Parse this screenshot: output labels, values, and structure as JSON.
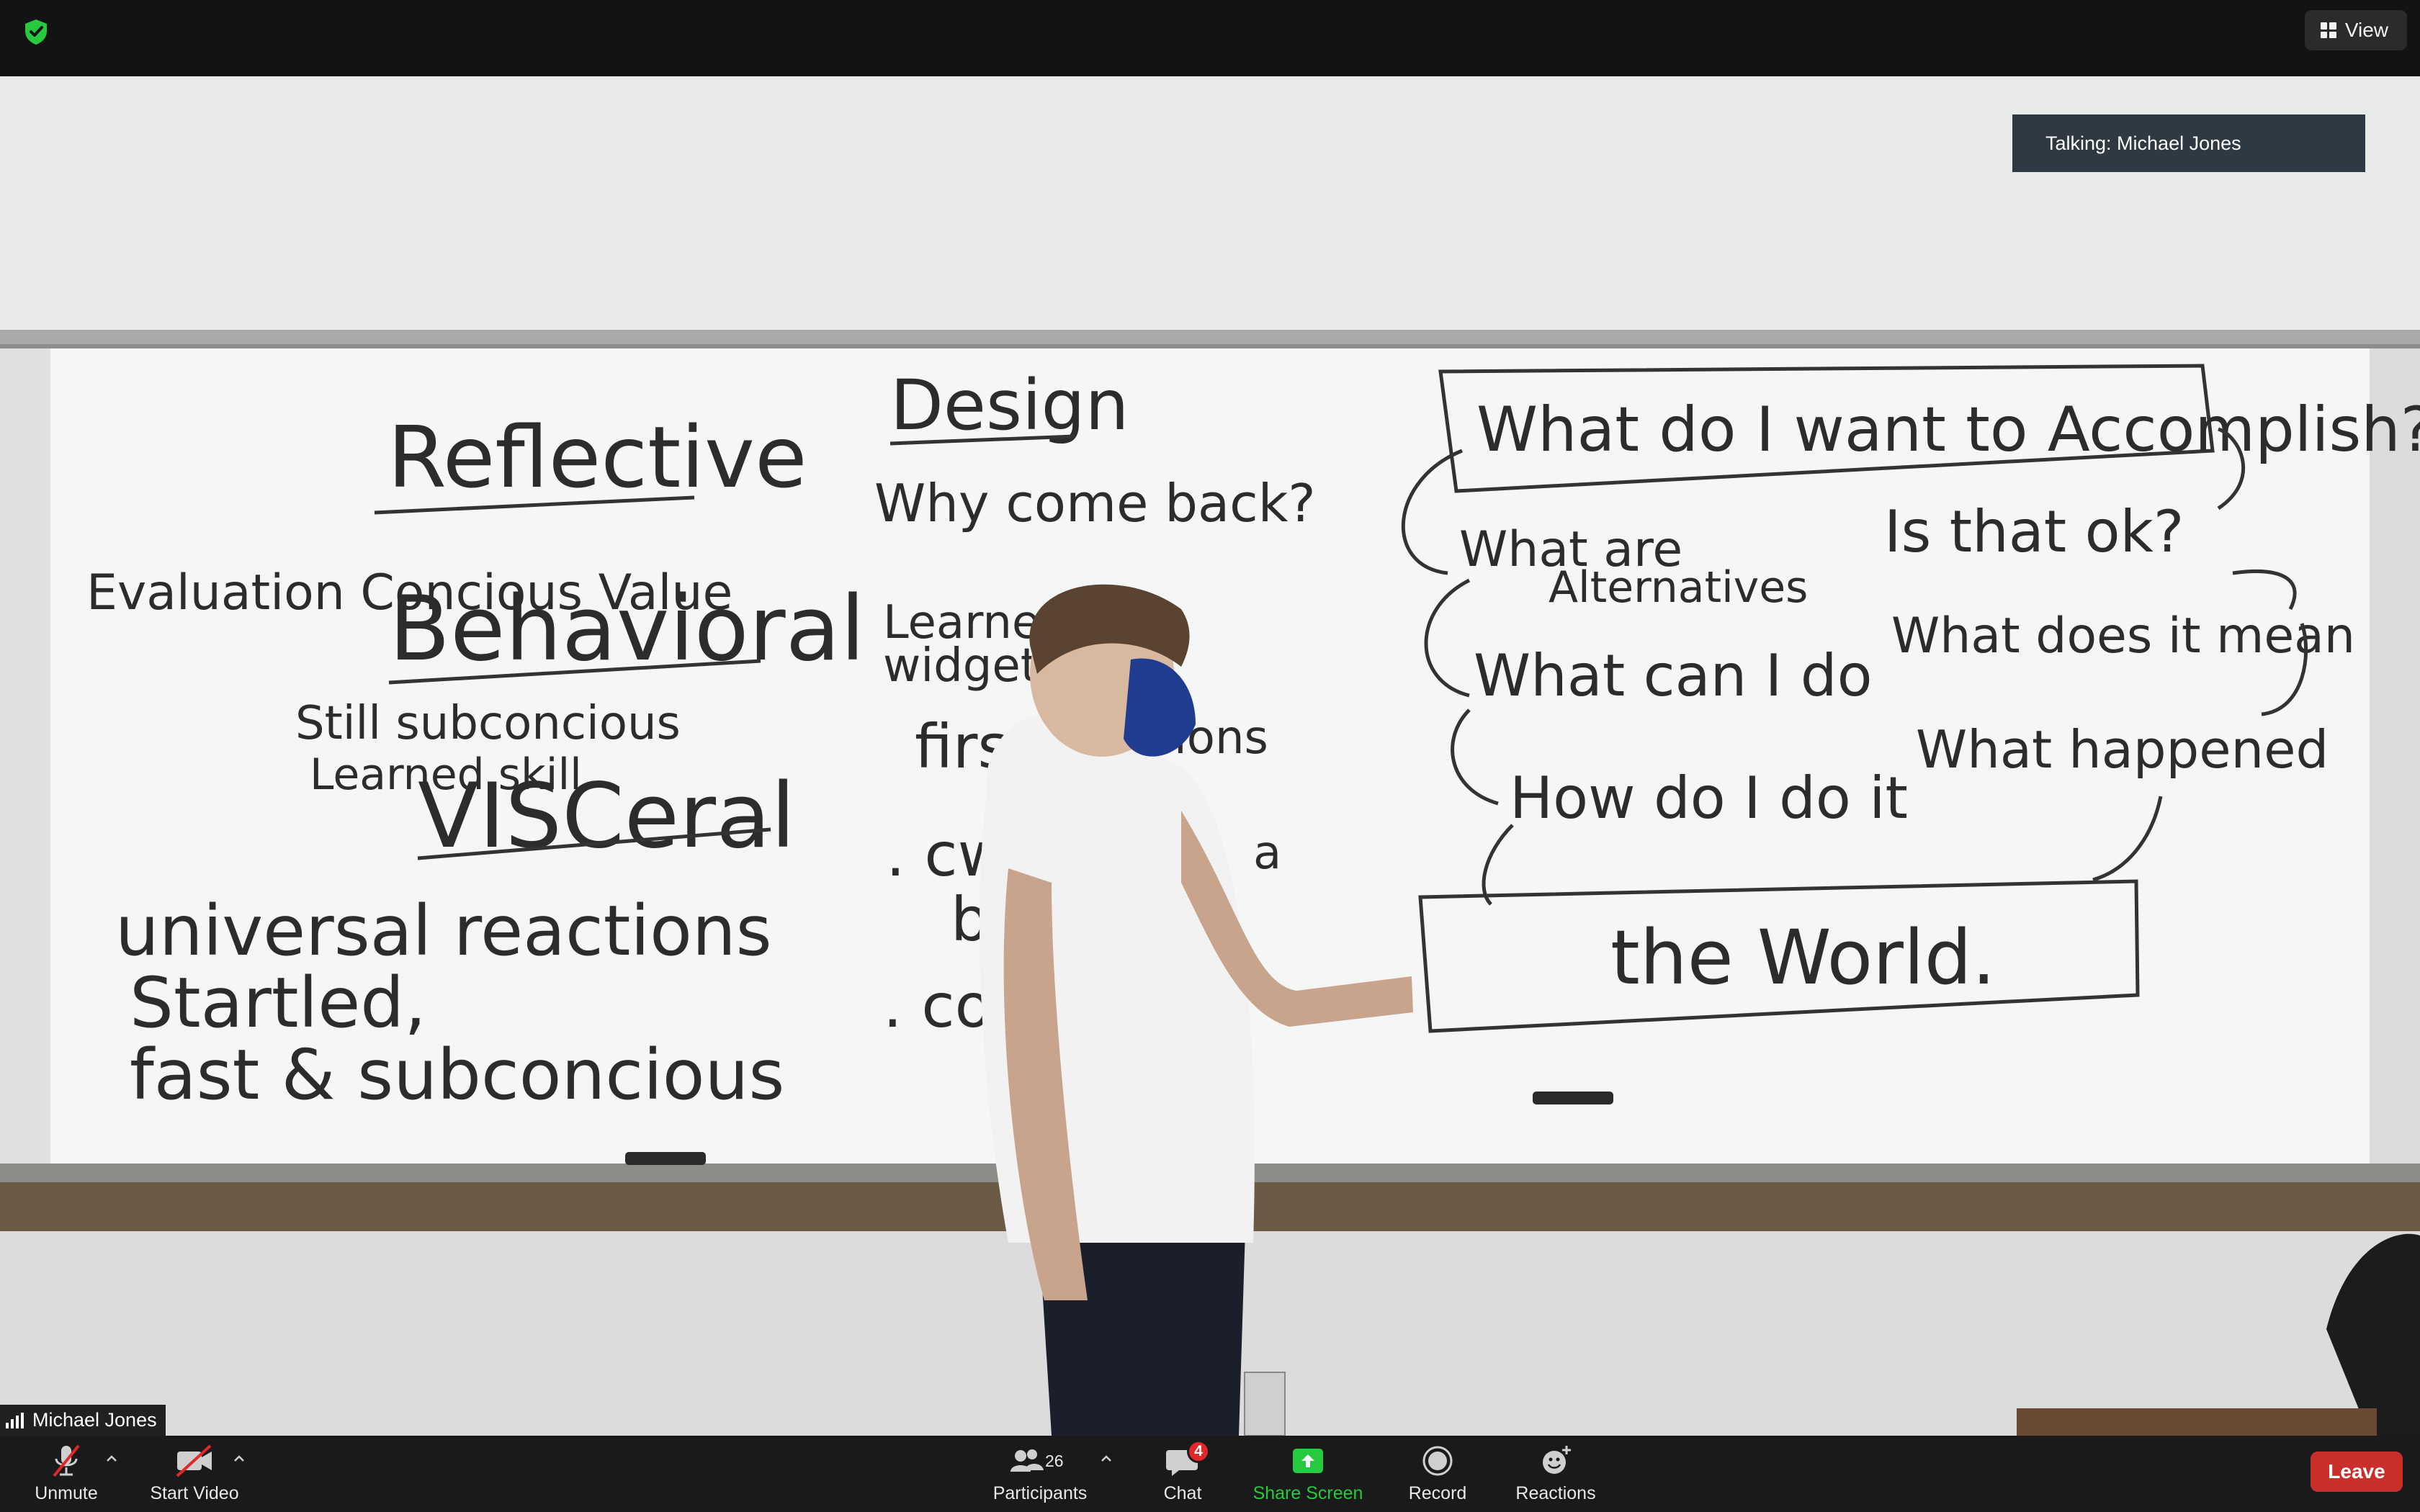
{
  "top_bar": {
    "security_icon": "shield-check-icon",
    "view_label": "View"
  },
  "video": {
    "talking_label": "Talking: Michael Jones",
    "participant_name": "Michael Jones",
    "whiteboard": {
      "left": {
        "reflective": "Reflective",
        "evaluation": "Evaluation Concious Value",
        "behavioral": "Behavioral",
        "skill": "Still subconcious",
        "learned": "Learned skill",
        "visceral": "VISCeral",
        "universal": "universal reactions",
        "startled": "Startled,",
        "fast": "fast & subconcious"
      },
      "middle": {
        "design": "Design",
        "why": "Why come back?",
        "learned": "Learned",
        "widget": "widget, c",
        "first": "first",
        "ions": "ions",
        "cw": ". cw",
        "b": "b",
        "a": "a",
        "colo": ". colo"
      },
      "right": {
        "accomplish": "What do I want to Accomplish?",
        "alternatives_1": "What are",
        "alternatives_2": "Alternatives",
        "can_i_do": "What can I do",
        "how_do_it": "How do I do it",
        "is_ok": "Is that ok?",
        "mean": "What does it mean",
        "happened": "What happened",
        "world": "the World."
      }
    }
  },
  "toolbar": {
    "unmute": "Unmute",
    "start_video": "Start Video",
    "participants": "Participants",
    "participants_count": "26",
    "chat": "Chat",
    "chat_badge": "4",
    "share_screen": "Share Screen",
    "record": "Record",
    "reactions": "Reactions",
    "leave": "Leave"
  },
  "colors": {
    "share_green": "#27c93f",
    "leave_red": "#c9302c",
    "talking_bg": "#2e3944"
  }
}
